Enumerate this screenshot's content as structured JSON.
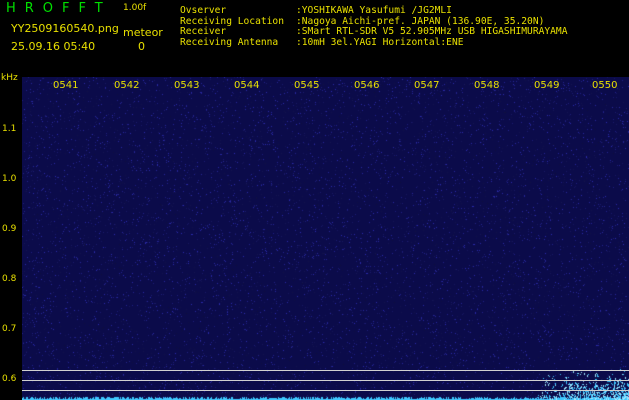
{
  "header": {
    "app_title": "HROFFT",
    "app_version": "1.00f",
    "file_name": "YY2509160540.png",
    "meteor_label": "meteor",
    "timestamp": "25.09.16 05:40",
    "meteor_count": "0"
  },
  "info": {
    "observer_label": "Ovserver",
    "observer_value": ":YOSHIKAWA Yasufumi /JG2MLI",
    "location_label": "Receiving Location",
    "location_value": ":Nagoya Aichi-pref. JAPAN (136.90E, 35.20N)",
    "receiver_label": "Receiver",
    "receiver_value": ":SMart RTL-SDR V5 52.905MHz USB HIGASHIMURAYAMA",
    "antenna_label": "Receiving Antenna",
    "antenna_value": ":10mH 3el.YAGI Horizontal:ENE"
  },
  "plot": {
    "y_unit": "kHz",
    "x_ticks": [
      "0541",
      "0542",
      "0543",
      "0544",
      "0545",
      "0546",
      "0547",
      "0548",
      "0549",
      "0550"
    ],
    "y_ticks": [
      "1.1",
      "1.0",
      "0.9",
      "0.8",
      "0.7",
      "0.6"
    ],
    "colors": {
      "background": "#0b0b4a",
      "speckle": "#2a2ac8",
      "signal": "#40c8ff",
      "text": "#e8e000",
      "title": "#00e000"
    }
  }
}
